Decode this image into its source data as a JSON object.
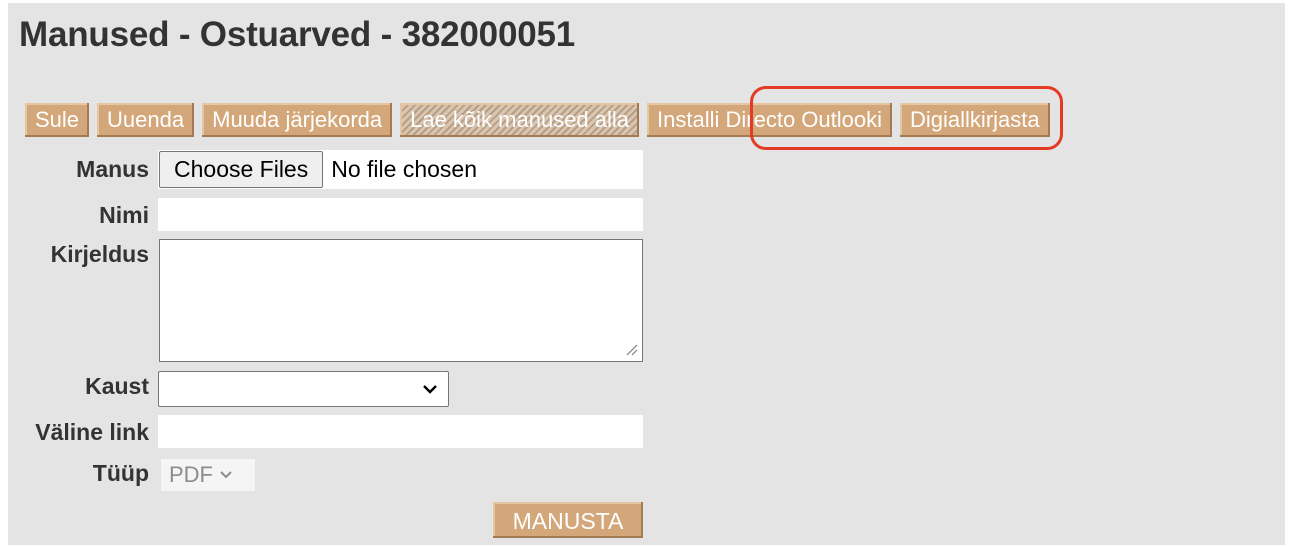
{
  "page": {
    "title": "Manused - Ostuarved - 382000051"
  },
  "toolbar": {
    "buttons": [
      {
        "label": "Sule"
      },
      {
        "label": "Uuenda"
      },
      {
        "label": "Muuda järjekorda"
      },
      {
        "label": "Lae kõik manused alla",
        "disabled": true
      },
      {
        "label": "Installi Directo Outlooki",
        "highlighted": true
      },
      {
        "label": "Digiallkirjasta"
      }
    ]
  },
  "form": {
    "attachment": {
      "label": "Manus",
      "button_label": "Choose Files",
      "status_text": "No file chosen"
    },
    "name": {
      "label": "Nimi",
      "value": ""
    },
    "description": {
      "label": "Kirjeldus",
      "value": ""
    },
    "folder": {
      "label": "Kaust",
      "selected": ""
    },
    "external_link": {
      "label": "Väline link",
      "value": ""
    },
    "type": {
      "label": "Tüüp",
      "selected": "PDF"
    },
    "submit_label": "MANUSTA"
  },
  "colors": {
    "button_bg": "#d3a77a",
    "panel_bg": "#e4e4e4",
    "highlight": "#e53a23"
  },
  "icons": {
    "select_chevron": "chevron-down-icon",
    "textarea_grip": "resize-grip-icon"
  }
}
